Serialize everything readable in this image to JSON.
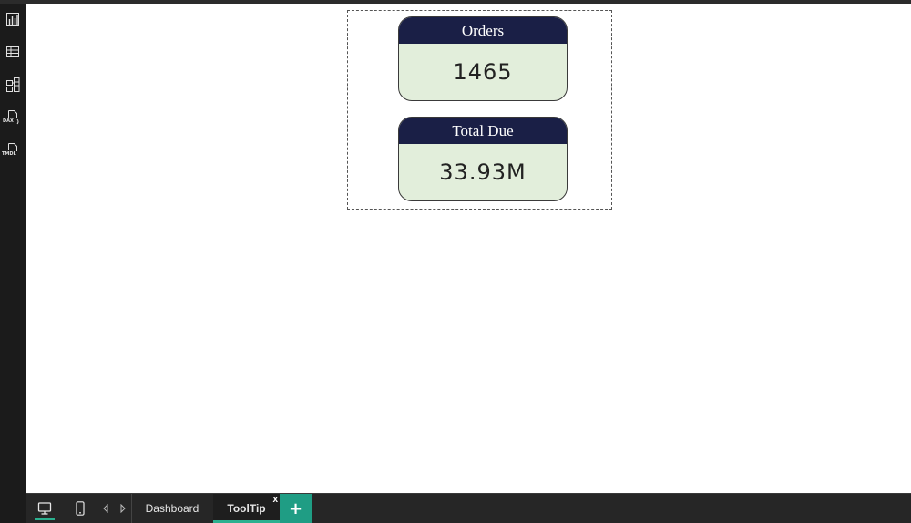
{
  "sidebar": {
    "items": [
      {
        "icon": "report-view-icon"
      },
      {
        "icon": "table-view-icon"
      },
      {
        "icon": "model-view-icon"
      },
      {
        "icon": "dax-query-icon",
        "badge": "DAX"
      },
      {
        "icon": "tmdl-view-icon",
        "badge": "TMDL"
      }
    ]
  },
  "cards": [
    {
      "title": "Orders",
      "value": "1465"
    },
    {
      "title": "Total Due",
      "value": "33.93M"
    }
  ],
  "bottombar": {
    "tabs": [
      {
        "label": "Dashboard",
        "active": false
      },
      {
        "label": "ToolTip",
        "active": true,
        "close": "x"
      }
    ],
    "add_label": "+"
  },
  "colors": {
    "card_header": "#1a1f46",
    "card_body": "#e2eedb",
    "accent": "#2bb08f",
    "add_button": "#1f9d84"
  }
}
